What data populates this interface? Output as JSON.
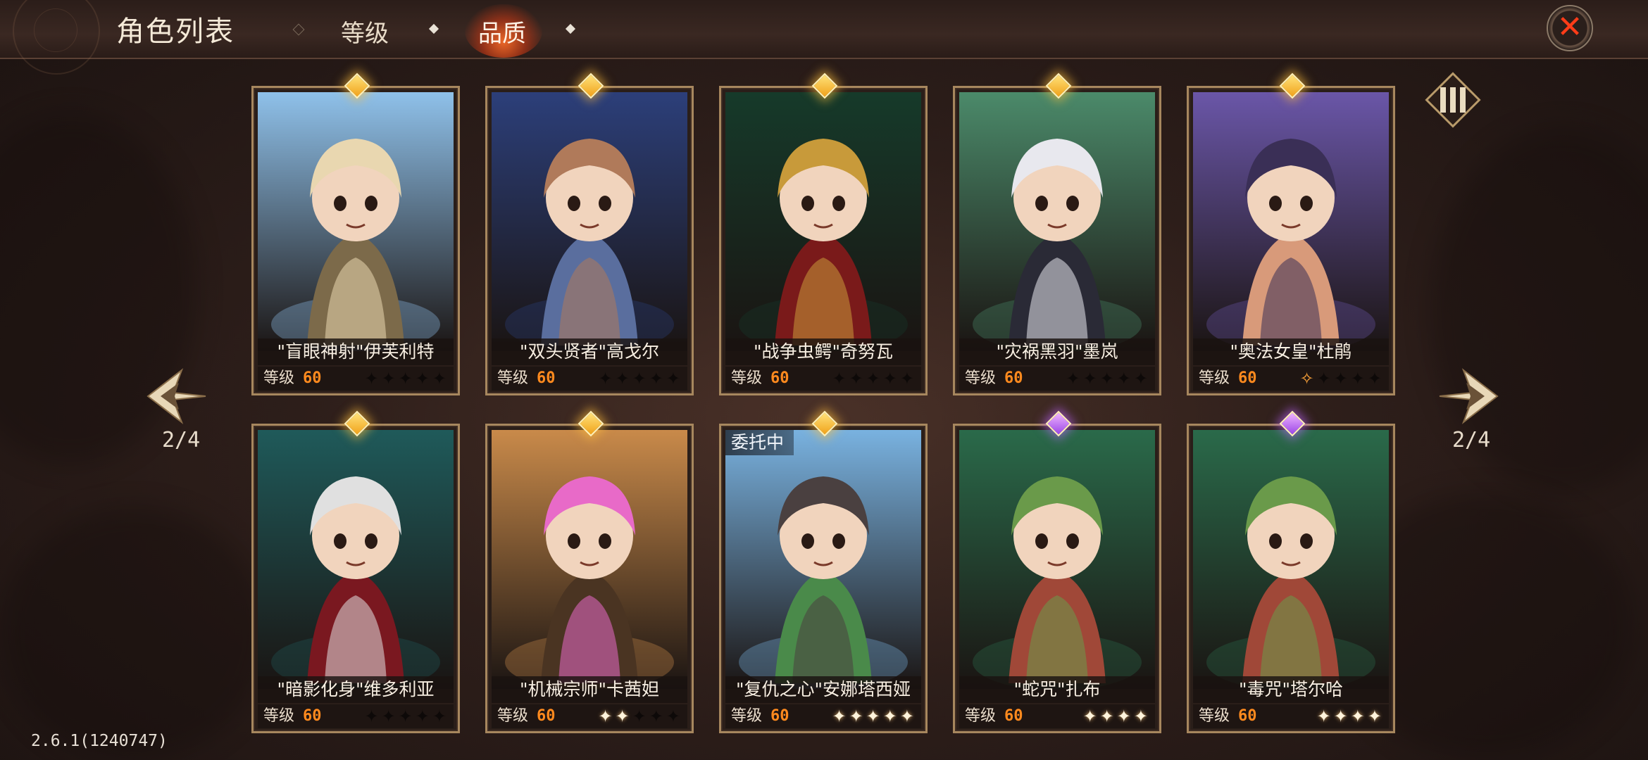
{
  "header": {
    "title": "角色列表",
    "tabs": [
      {
        "label": "等级",
        "active": false
      },
      {
        "label": "品质",
        "active": true
      }
    ],
    "close_icon": "close-icon"
  },
  "pager": {
    "left": "2/4",
    "right": "2/4"
  },
  "version": "2.6.1(1240747)",
  "level_label": "等级",
  "cards": [
    {
      "name": "\"盲眼神射\"伊芙利特",
      "level": "60",
      "gem": "gold",
      "stars": [
        0,
        0,
        0,
        0,
        0
      ],
      "palette": [
        "#8fc1ea",
        "#e9d7b0",
        "#7c6a4a"
      ],
      "badge": ""
    },
    {
      "name": "\"双头贤者\"高戈尔",
      "level": "60",
      "gem": "gold",
      "stars": [
        0,
        0,
        0,
        0,
        0
      ],
      "palette": [
        "#2c3f7a",
        "#b07a5a",
        "#5a6e9e"
      ],
      "badge": ""
    },
    {
      "name": "\"战争虫鳄\"奇努瓦",
      "level": "60",
      "gem": "gold",
      "stars": [
        0,
        0,
        0,
        0,
        0
      ],
      "palette": [
        "#163a2a",
        "#c89a3a",
        "#7a1a1a"
      ],
      "badge": ""
    },
    {
      "name": "\"灾祸黑羽\"墨岚",
      "level": "60",
      "gem": "gold",
      "stars": [
        0,
        0,
        0,
        0,
        0
      ],
      "palette": [
        "#4b8a6a",
        "#e8e8ee",
        "#2a2a36"
      ],
      "badge": ""
    },
    {
      "name": "\"奥法女皇\"杜鹃",
      "level": "60",
      "gem": "gold",
      "stars": [
        2,
        0,
        0,
        0,
        0
      ],
      "palette": [
        "#6a56a8",
        "#3a2f56",
        "#d89a7a"
      ],
      "badge": ""
    },
    {
      "name": "\"暗影化身\"维多利亚",
      "level": "60",
      "gem": "gold",
      "stars": [
        0,
        0,
        0,
        0,
        0
      ],
      "palette": [
        "#1f5a5a",
        "#e0e0e0",
        "#7a1820"
      ],
      "badge": ""
    },
    {
      "name": "\"机械宗师\"卡茜妲",
      "level": "60",
      "gem": "gold",
      "stars": [
        1,
        1,
        0,
        0,
        0
      ],
      "palette": [
        "#c98a4a",
        "#e86ac8",
        "#4a3422"
      ],
      "badge": ""
    },
    {
      "name": "\"复仇之心\"安娜塔西娅",
      "level": "60",
      "gem": "gold",
      "stars": [
        1,
        1,
        1,
        1,
        1
      ],
      "palette": [
        "#79b2e0",
        "#4a4040",
        "#4a8a4a"
      ],
      "badge": "委托中"
    },
    {
      "name": "\"蛇咒\"扎布",
      "level": "60",
      "gem": "purple",
      "stars": [
        1,
        1,
        1,
        1
      ],
      "palette": [
        "#2a6a4a",
        "#6a9a4a",
        "#a04838"
      ],
      "badge": ""
    },
    {
      "name": "\"毒咒\"塔尔哈",
      "level": "60",
      "gem": "purple",
      "stars": [
        1,
        1,
        1,
        1
      ],
      "palette": [
        "#2a6a4a",
        "#6a9a4a",
        "#a04838"
      ],
      "badge": ""
    }
  ],
  "colors": {
    "accent": "#ff8a1e",
    "frame": "#a7875e",
    "close": "#ff3c18"
  }
}
